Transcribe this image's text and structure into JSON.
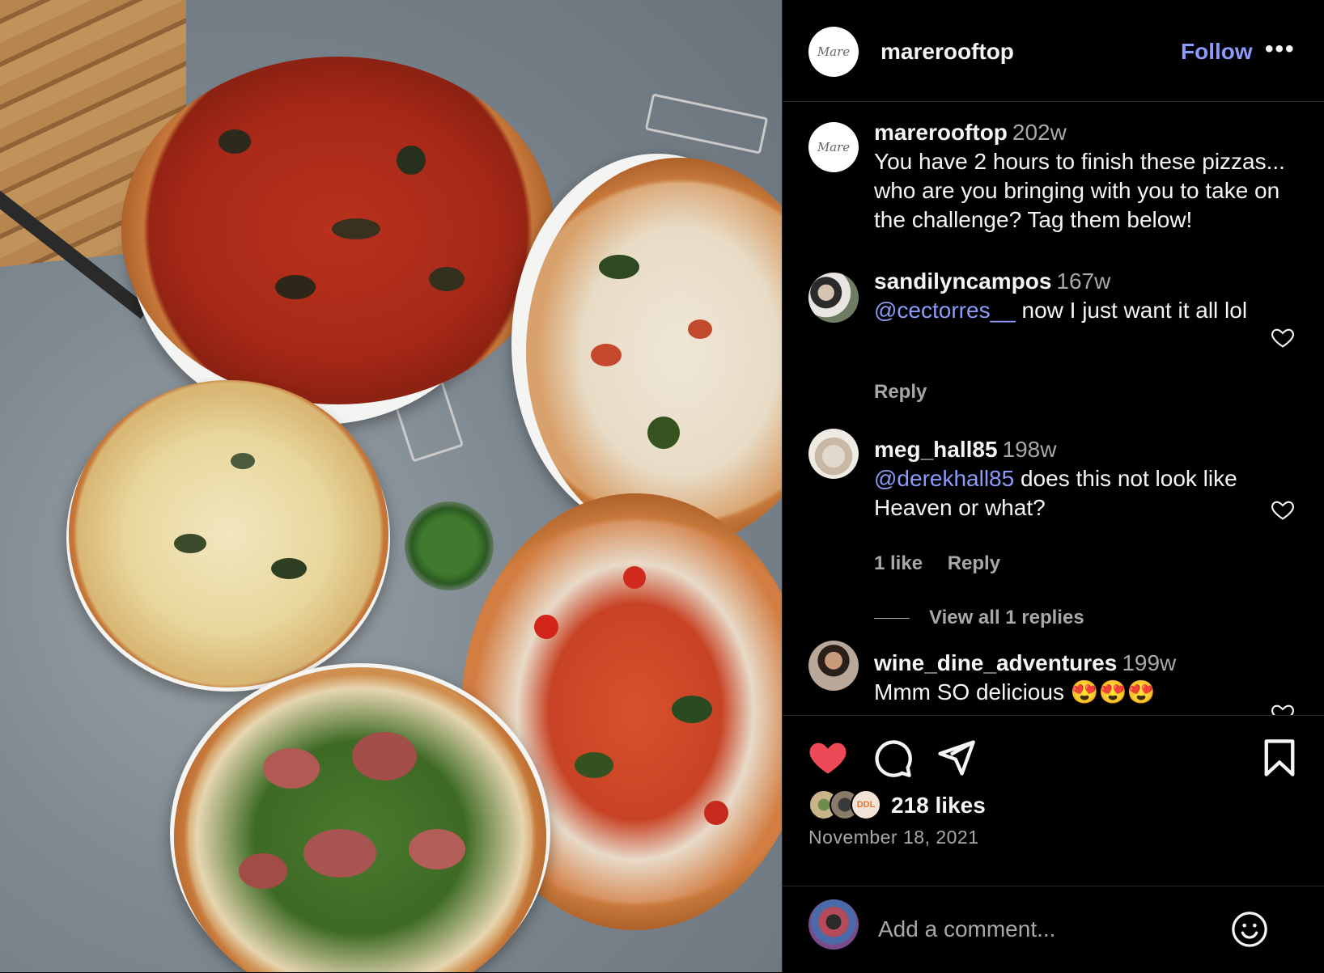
{
  "post": {
    "username": "marerooftop",
    "logo_text": "Mare",
    "follow_label": "Follow",
    "more_label": "•••",
    "caption": {
      "username": "marerooftop",
      "age": "202w",
      "text": "You have 2 hours to finish these pizzas... who are you bringing with you to take on the challenge? Tag them below!"
    }
  },
  "comments": [
    {
      "username": "sandilyncampos",
      "age": "167w",
      "mention": "@cectorres__",
      "text": " now I just want it all lol",
      "likes_label": "",
      "reply_label": "Reply"
    },
    {
      "username": "meg_hall85",
      "age": "198w",
      "mention": "@derekhall85",
      "text": " does this not look like Heaven or what?",
      "likes_label": "1 like",
      "reply_label": "Reply",
      "view_replies": "View all 1 replies"
    },
    {
      "username": "wine_dine_adventures",
      "age": "199w",
      "mention": "",
      "text": "Mmm SO delicious 😍😍😍"
    }
  ],
  "actions": {
    "like_icon": "heart-filled-icon",
    "comment_icon": "comment-icon",
    "share_icon": "paper-plane-icon",
    "save_icon": "bookmark-icon",
    "liked": true,
    "like_color": "#ed4956"
  },
  "likes": {
    "count_label": "218 likes",
    "badge_text": "DDL"
  },
  "date": "November 18, 2021",
  "add_comment": {
    "placeholder": "Add a comment...",
    "emoji_icon": "smiley-icon"
  },
  "colors": {
    "background": "#000000",
    "link": "#8b9bf9",
    "muted": "#a8a8a8",
    "divider": "#262626"
  }
}
